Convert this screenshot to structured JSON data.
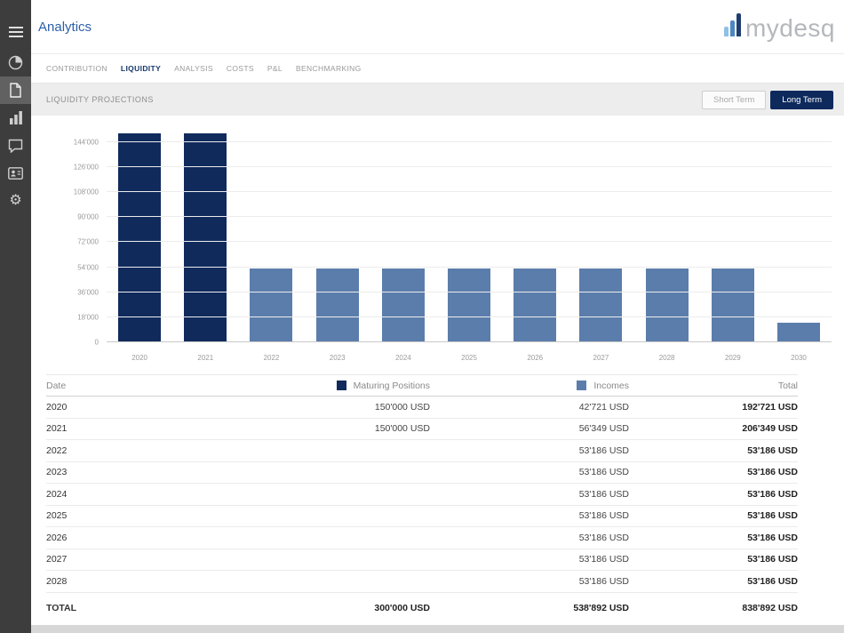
{
  "header": {
    "title": "Analytics",
    "brand": "mydesq"
  },
  "sidebar": {
    "icons": [
      "menu",
      "pie-chart",
      "documents",
      "bar-chart",
      "chat",
      "contacts",
      "settings"
    ],
    "active": "documents"
  },
  "tabs": [
    {
      "label": "CONTRIBUTION",
      "active": false
    },
    {
      "label": "LIQUIDITY",
      "active": true
    },
    {
      "label": "ANALYSIS",
      "active": false
    },
    {
      "label": "COSTS",
      "active": false
    },
    {
      "label": "P&L",
      "active": false
    },
    {
      "label": "BENCHMARKING",
      "active": false
    }
  ],
  "section": {
    "title": "LIQUIDITY PROJECTIONS",
    "toggles": [
      {
        "label": "Short Term",
        "active": false
      },
      {
        "label": "Long Term",
        "active": true
      }
    ]
  },
  "chart_data": {
    "type": "bar",
    "title": "LIQUIDITY PROJECTIONS",
    "categories": [
      "2020",
      "2021",
      "2022",
      "2023",
      "2024",
      "2025",
      "2026",
      "2027",
      "2028",
      "2029",
      "2030"
    ],
    "series": [
      {
        "name": "Maturing Positions",
        "color": "#102a5c",
        "values": [
          150000,
          150000,
          0,
          0,
          0,
          0,
          0,
          0,
          0,
          0,
          0
        ]
      },
      {
        "name": "Incomes",
        "color": "#5b7dab",
        "values": [
          0,
          0,
          53186,
          53186,
          53186,
          53186,
          53186,
          53186,
          53186,
          53186,
          14334
        ]
      }
    ],
    "bar_values": [
      150000,
      150000,
      53186,
      53186,
      53186,
      53186,
      53186,
      53186,
      53186,
      53186,
      14334
    ],
    "bar_series": [
      "Maturing Positions",
      "Maturing Positions",
      "Incomes",
      "Incomes",
      "Incomes",
      "Incomes",
      "Incomes",
      "Incomes",
      "Incomes",
      "Incomes",
      "Incomes"
    ],
    "yticks": [
      0,
      18000,
      36000,
      54000,
      72000,
      90000,
      108000,
      126000,
      144000
    ],
    "ytick_labels": [
      "0",
      "18'000",
      "36'000",
      "54'000",
      "72'000",
      "90'000",
      "108'000",
      "126'000",
      "144'000"
    ],
    "ymax": 154000,
    "grid": true,
    "legend": [
      "Maturing Positions",
      "Incomes"
    ],
    "legend_position": "table-header"
  },
  "table": {
    "header": {
      "date": "Date",
      "maturing": "Maturing Positions",
      "incomes": "Incomes",
      "total": "Total"
    },
    "rows": [
      {
        "date": "2020",
        "maturing": "150'000 USD",
        "incomes": "42'721 USD",
        "total": "192'721 USD"
      },
      {
        "date": "2021",
        "maturing": "150'000 USD",
        "incomes": "56'349 USD",
        "total": "206'349 USD"
      },
      {
        "date": "2022",
        "maturing": "",
        "incomes": "53'186 USD",
        "total": "53'186 USD"
      },
      {
        "date": "2023",
        "maturing": "",
        "incomes": "53'186 USD",
        "total": "53'186 USD"
      },
      {
        "date": "2024",
        "maturing": "",
        "incomes": "53'186 USD",
        "total": "53'186 USD"
      },
      {
        "date": "2025",
        "maturing": "",
        "incomes": "53'186 USD",
        "total": "53'186 USD"
      },
      {
        "date": "2026",
        "maturing": "",
        "incomes": "53'186 USD",
        "total": "53'186 USD"
      },
      {
        "date": "2027",
        "maturing": "",
        "incomes": "53'186 USD",
        "total": "53'186 USD"
      },
      {
        "date": "2028",
        "maturing": "",
        "incomes": "53'186 USD",
        "total": "53'186 USD"
      }
    ],
    "total_row": {
      "date": "TOTAL",
      "maturing": "300'000 USD",
      "incomes": "538'892 USD",
      "total": "838'892 USD"
    }
  },
  "colors": {
    "maturing_navy": "#102a5c",
    "income_steel_blue": "#5b7dab",
    "accent_blue": "#2b5fa8",
    "sidebar_bg": "#3d3d3d",
    "long_term_button": "#0e2a5c"
  }
}
